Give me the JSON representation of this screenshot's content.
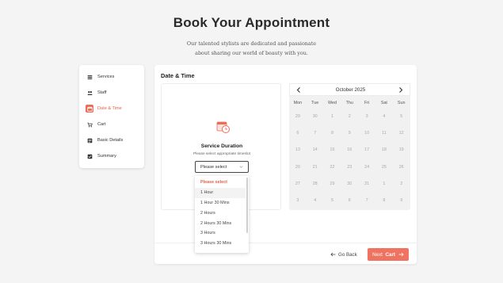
{
  "header": {
    "title": "Book Your Appointment",
    "subtitle_line1": "Our talented stylists are dedicated and passionate",
    "subtitle_line2": "about sharing our world of beauty with you."
  },
  "sidebar": {
    "items": [
      {
        "label": "Services",
        "icon": "list-icon",
        "active": false
      },
      {
        "label": "Staff",
        "icon": "users-icon",
        "active": false
      },
      {
        "label": "Date & Time",
        "icon": "calendar-icon",
        "active": true
      },
      {
        "label": "Cart",
        "icon": "cart-icon",
        "active": false
      },
      {
        "label": "Basic Details",
        "icon": "id-card-icon",
        "active": false
      },
      {
        "label": "Summary",
        "icon": "check-list-icon",
        "active": false
      }
    ]
  },
  "panel": {
    "title": "Date & Time"
  },
  "service": {
    "title": "Service Duration",
    "subtitle": "Please select appropriate timeslot",
    "select_value": "Please select",
    "options": [
      "Please select",
      "1 Hour",
      "1 Hour 30 Mins",
      "2 Hours",
      "2 Hours 30 Mins",
      "3 Hours",
      "3 Hours 30 Mins"
    ],
    "highlighted_option": "1 Hour"
  },
  "calendar": {
    "month_label": "October 2025",
    "weekdays": [
      "Mon",
      "Tue",
      "Wed",
      "Thu",
      "Fri",
      "Sat",
      "Sun"
    ],
    "weeks": [
      [
        "29",
        "30",
        "1",
        "2",
        "3",
        "4",
        "5"
      ],
      [
        "6",
        "7",
        "8",
        "9",
        "10",
        "11",
        "12"
      ],
      [
        "13",
        "14",
        "15",
        "16",
        "17",
        "18",
        "19"
      ],
      [
        "20",
        "21",
        "22",
        "23",
        "24",
        "25",
        "26"
      ],
      [
        "27",
        "28",
        "29",
        "30",
        "31",
        "1",
        "2"
      ],
      [
        "3",
        "4",
        "5",
        "6",
        "7",
        "8",
        "9"
      ]
    ]
  },
  "footer": {
    "back_label": "Go Back",
    "next_prefix": "Next",
    "next_bold": "Cart"
  },
  "colors": {
    "accent": "#f07361",
    "calendar_bg": "#f1f1f1"
  }
}
